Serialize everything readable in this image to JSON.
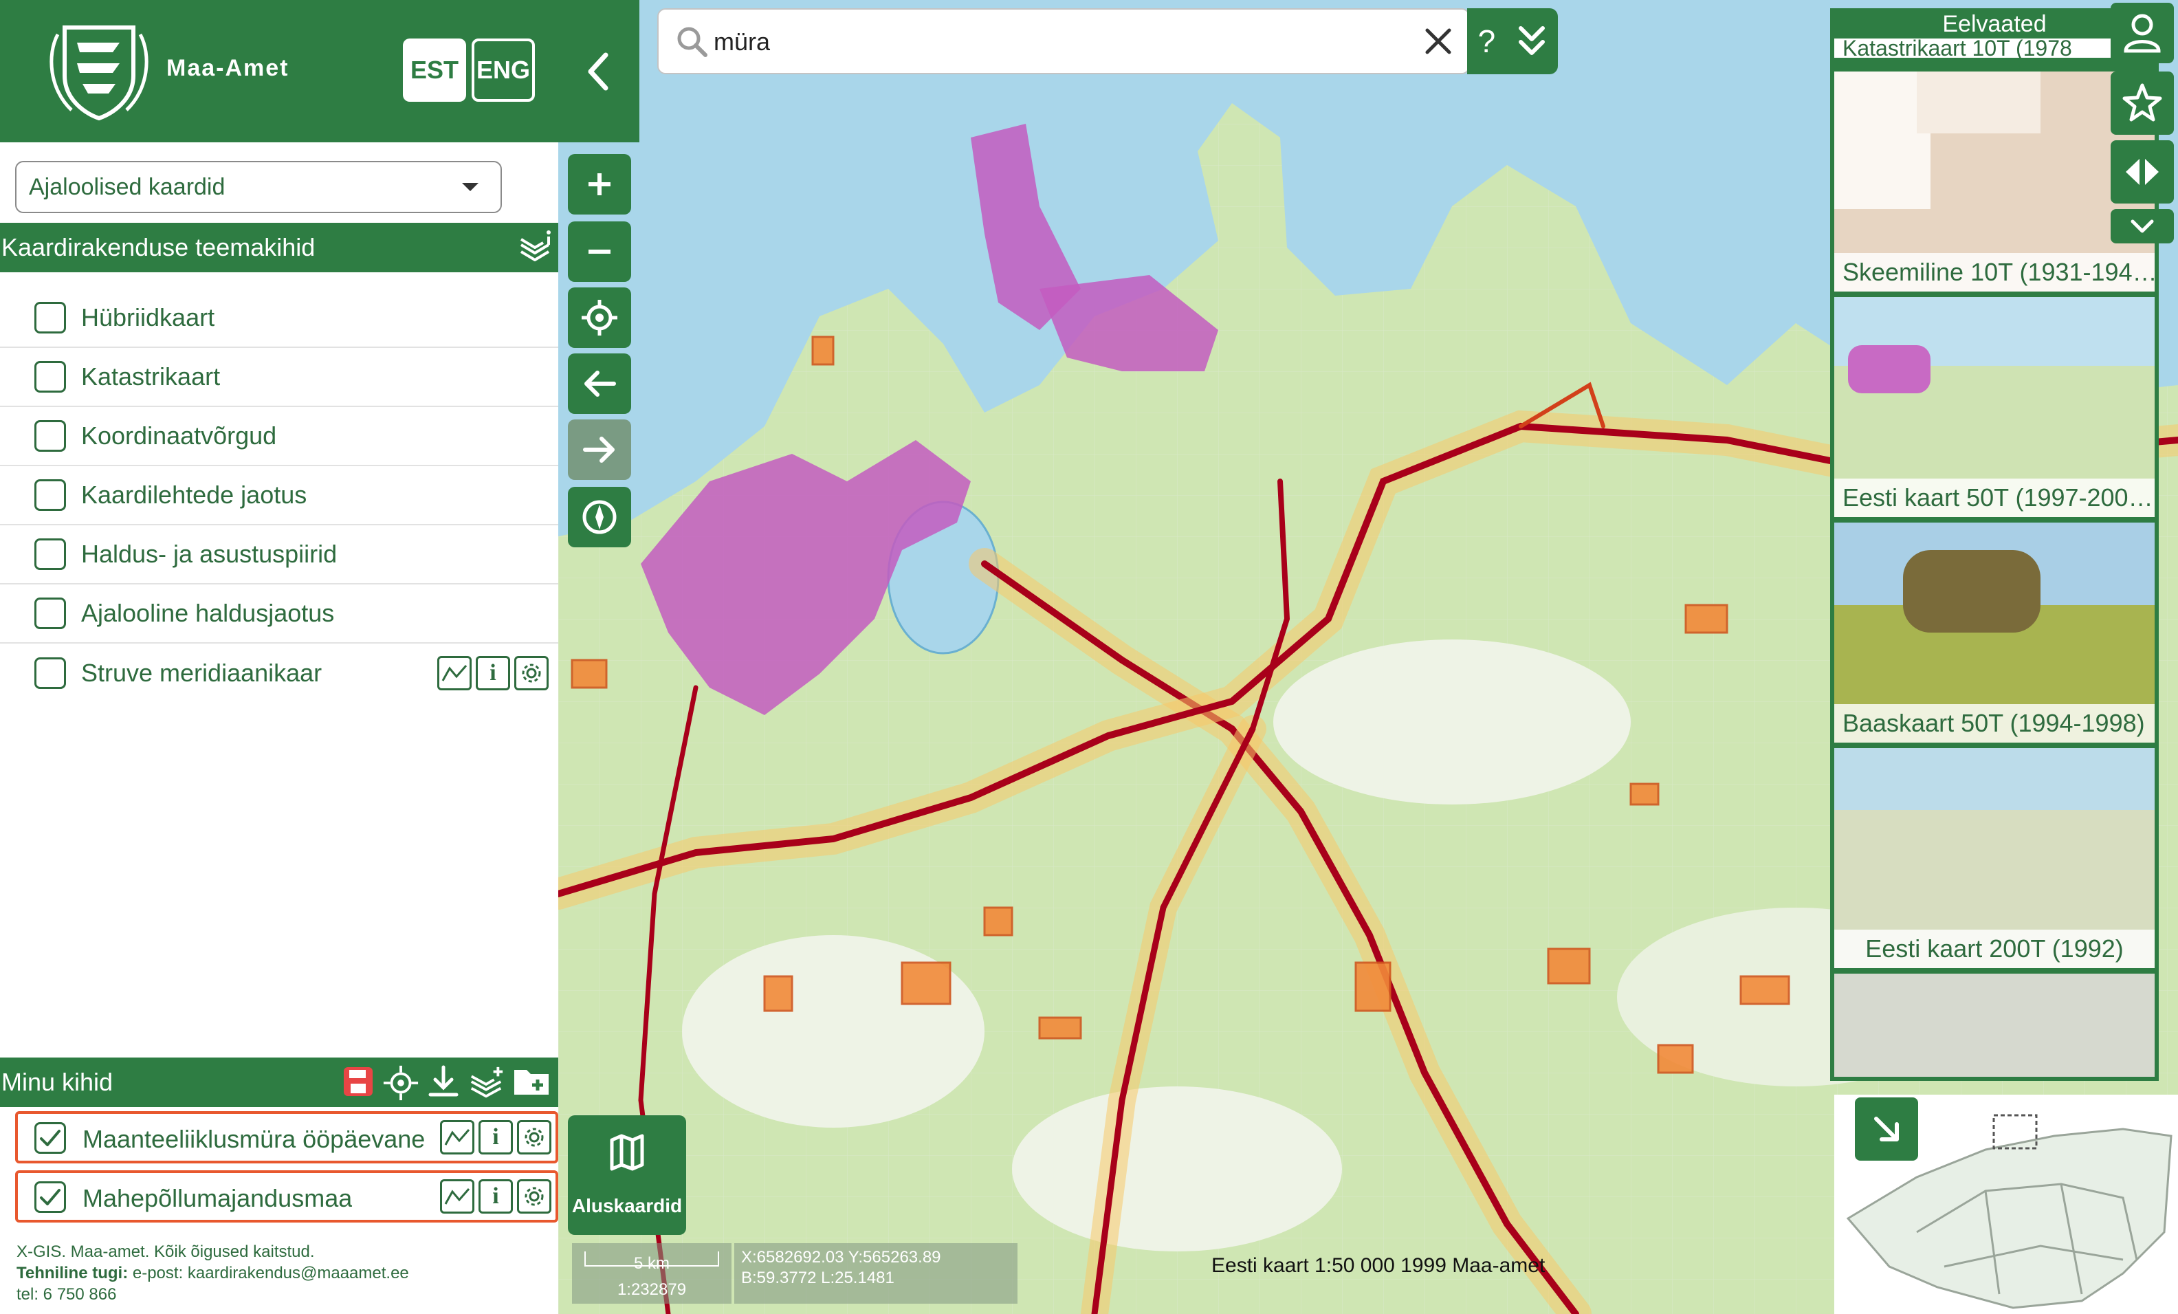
{
  "header": {
    "org_name": "Maa-Amet",
    "lang_est": "EST",
    "lang_eng": "ENG"
  },
  "theme_select": {
    "value": "Ajaloolised kaardid"
  },
  "theme_layers": {
    "title": "Kaardirakenduse teemakihid",
    "items": [
      {
        "label": "Hübriidkaart",
        "checked": false
      },
      {
        "label": "Katastrikaart",
        "checked": false
      },
      {
        "label": "Koordinaatvõrgud",
        "checked": false
      },
      {
        "label": "Kaardilehtede jaotus",
        "checked": false
      },
      {
        "label": "Haldus- ja asustuspiirid",
        "checked": false
      },
      {
        "label": "Ajalooline haldusjaotus",
        "checked": false
      },
      {
        "label": "Struve meridiaanikaar",
        "checked": false
      }
    ]
  },
  "my_layers": {
    "title": "Minu kihid",
    "items": [
      {
        "label": "Maanteeliiklusmüra ööpäevane",
        "checked": true
      },
      {
        "label": "Mahepõllumajandusmaa",
        "checked": true
      }
    ]
  },
  "footer": {
    "line1": "X-GIS. Maa-amet. Kõik õigused kaitstud.",
    "support_label": "Tehniline tugi:",
    "support_text": " e-post: kaardirakendus@maaamet.ee",
    "phone": "tel: 6 750 866"
  },
  "search": {
    "value": "müra",
    "help": "?"
  },
  "basemaps_button": "Aluskaardid",
  "scale": {
    "distance": "5 km",
    "ratio": "1:232879"
  },
  "coords": {
    "xy": "X:6582692.03 Y:565263.89",
    "bl": "B:59.3772 L:25.1481"
  },
  "attribution": "Eesti kaart 1:50 000 1999 Maa-amet",
  "previews": {
    "title": "Eelvaated",
    "items": [
      {
        "label": "Katastrikaart 10T (1978"
      },
      {
        "label": "Skeemiline 10T (1931-194…"
      },
      {
        "label": "Eesti kaart 50T (1997-200…"
      },
      {
        "label": "Baaskaart 50T (1994-1998)"
      },
      {
        "label": "Eesti kaart 200T (1992)"
      }
    ]
  },
  "colors": {
    "brand_green": "#2e7d43",
    "highlight_orange": "#e8582e",
    "text_green": "#2e6b3e"
  }
}
